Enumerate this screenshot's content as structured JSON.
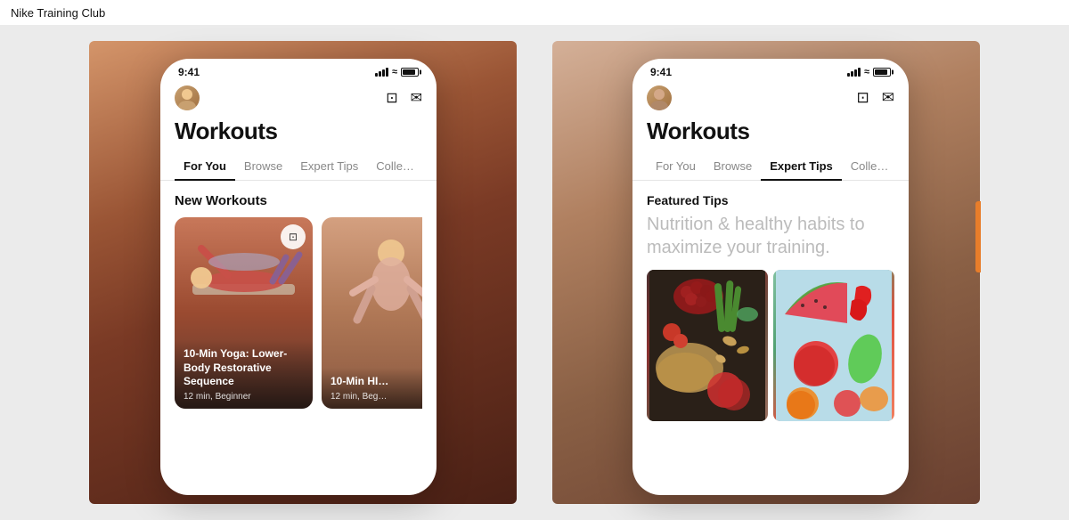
{
  "app": {
    "title": "Nike Training Club"
  },
  "left_phone": {
    "status_time": "9:41",
    "workouts_title": "Workouts",
    "tabs": [
      {
        "label": "For You",
        "active": true
      },
      {
        "label": "Browse",
        "active": false
      },
      {
        "label": "Expert Tips",
        "active": false
      },
      {
        "label": "Colle…",
        "active": false
      }
    ],
    "section": "New Workouts",
    "cards": [
      {
        "title": "10-Min Yoga: Lower-Body Restorative Sequence",
        "meta": "12 min, Beginner",
        "has_bookmark": true
      },
      {
        "title": "10-Min HI…",
        "meta": "12 min, Beg…",
        "has_bookmark": false
      }
    ]
  },
  "right_phone": {
    "status_time": "9:41",
    "workouts_title": "Workouts",
    "tabs": [
      {
        "label": "For You",
        "active": false
      },
      {
        "label": "Browse",
        "active": false
      },
      {
        "label": "Expert Tips",
        "active": true
      },
      {
        "label": "Colle…",
        "active": false
      }
    ],
    "featured_tips_label": "Featured Tips",
    "featured_tips_subtitle": "Nutrition & healthy habits to maximize your training.",
    "images_alt": [
      "food and nutrition photo",
      "fruit and vegetables photo"
    ]
  },
  "icons": {
    "bookmark": "🔖",
    "bookmark_outline": "□",
    "message": "✉",
    "signal": "▐▐▐▐",
    "wifi": "wifi",
    "battery": "battery"
  }
}
